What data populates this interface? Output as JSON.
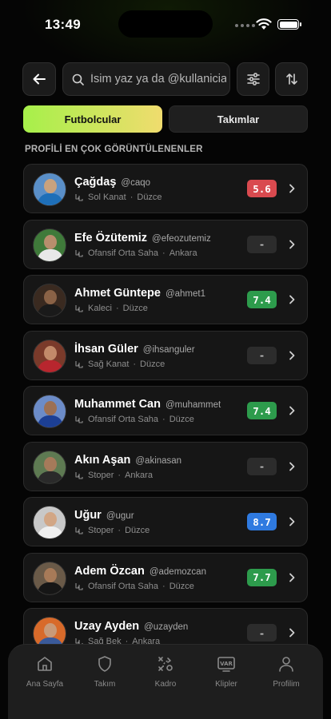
{
  "status": {
    "time": "13:49"
  },
  "search": {
    "placeholder": "İsim yaz ya da @kullaniciadi"
  },
  "tabs": {
    "players": "Futbolcular",
    "teams": "Takımlar"
  },
  "section_title": "PROFİLİ EN ÇOK GÖRÜNTÜLENENLER",
  "players": [
    {
      "name": "Çağdaş",
      "handle": "@caqo",
      "position": "Sol Kanat",
      "city": "Düzce",
      "rating": "5.6",
      "rating_color": "#d94a4f"
    },
    {
      "name": "Efe Özütemiz",
      "handle": "@efeozutemiz",
      "position": "Ofansif Orta Saha",
      "city": "Ankara",
      "rating": "-",
      "rating_color": "#2c2c2c"
    },
    {
      "name": "Ahmet Güntepe",
      "handle": "@ahmet1",
      "position": "Kaleci",
      "city": "Düzce",
      "rating": "7.4",
      "rating_color": "#2d9b4c"
    },
    {
      "name": "İhsan Güler",
      "handle": "@ihsanguler",
      "position": "Sağ Kanat",
      "city": "Düzce",
      "rating": "-",
      "rating_color": "#2c2c2c"
    },
    {
      "name": "Muhammet Can",
      "handle": "@muhammet",
      "position": "Ofansif Orta Saha",
      "city": "Düzce",
      "rating": "7.4",
      "rating_color": "#2d9b4c"
    },
    {
      "name": "Akın Aşan",
      "handle": "@akinasan",
      "position": "Stoper",
      "city": "Ankara",
      "rating": "-",
      "rating_color": "#2c2c2c"
    },
    {
      "name": "Uğur",
      "handle": "@ugur",
      "position": "Stoper",
      "city": "Düzce",
      "rating": "8.7",
      "rating_color": "#2f7ae0"
    },
    {
      "name": "Adem Özcan",
      "handle": "@ademozcan",
      "position": "Ofansif Orta Saha",
      "city": "Düzce",
      "rating": "7.7",
      "rating_color": "#2d9b4c"
    },
    {
      "name": "Uzay Ayden",
      "handle": "@uzayden",
      "position": "Sağ Bek",
      "city": "Ankara",
      "rating": "-",
      "rating_color": "#2c2c2c"
    }
  ],
  "nav": {
    "home": "Ana Sayfa",
    "team": "Takım",
    "squad": "Kadro",
    "clips": "Klipler",
    "profile": "Profilim"
  },
  "colors": {
    "accent_start": "#a6f04a",
    "accent_end": "#f0dc6e",
    "background": "#050505",
    "card": "#161616"
  }
}
